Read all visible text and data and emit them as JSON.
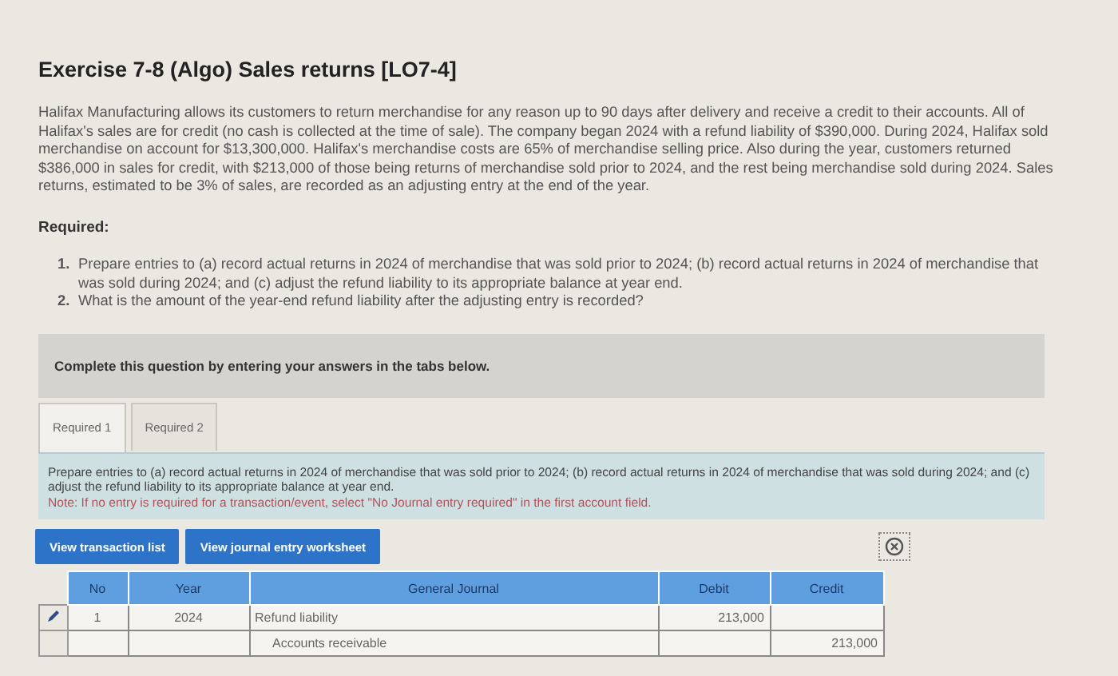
{
  "title": "Exercise 7-8 (Algo) Sales returns [LO7-4]",
  "problem": "Halifax Manufacturing allows its customers to return merchandise for any reason up to 90 days after delivery and receive a credit to their accounts. All of Halifax's sales are for credit (no cash is collected at the time of sale). The company began 2024 with a refund liability of $390,000. During 2024, Halifax sold merchandise on account for $13,300,000. Halifax's merchandise costs are 65% of merchandise selling price. Also during the year, customers returned $386,000 in sales for credit, with $213,000 of those being returns of merchandise sold prior to 2024, and the rest being merchandise sold during 2024. Sales returns, estimated to be 3% of sales, are recorded as an adjusting entry at the end of the year.",
  "required_heading": "Required:",
  "requirements": [
    {
      "number": "1.",
      "text": "Prepare entries to (a) record actual returns in 2024 of merchandise that was sold prior to 2024; (b) record actual returns in 2024 of merchandise that was sold during 2024; and (c) adjust the refund liability to its appropriate balance at year end."
    },
    {
      "number": "2.",
      "text": "What is the amount of the year-end refund liability after the adjusting entry is recorded?"
    }
  ],
  "banner": "Complete this question by entering your answers in the tabs below.",
  "tabs": [
    {
      "label": "Required 1",
      "selected": true
    },
    {
      "label": "Required 2",
      "selected": false
    }
  ],
  "instructions": "Prepare entries to (a) record actual returns in 2024 of merchandise that was sold prior to 2024; (b) record actual returns in 2024 of merchandise that was sold during 2024; and (c) adjust the refund liability to its appropriate balance at year end.",
  "note": "Note: If no entry is required for a transaction/event, select \"No Journal entry required\" in the first account field.",
  "buttons": [
    "View transaction list",
    "View journal entry worksheet"
  ],
  "table": {
    "columns": [
      "No",
      "Year",
      "General Journal",
      "Debit",
      "Credit"
    ],
    "rows": [
      {
        "no": "1",
        "year": "2024",
        "account": "Refund liability",
        "debit": "213,000",
        "credit": "",
        "kind": "debit",
        "editable": true
      },
      {
        "no": "",
        "year": "",
        "account": "Accounts receivable",
        "debit": "",
        "credit": "213,000",
        "kind": "credit",
        "editable": false
      }
    ]
  }
}
